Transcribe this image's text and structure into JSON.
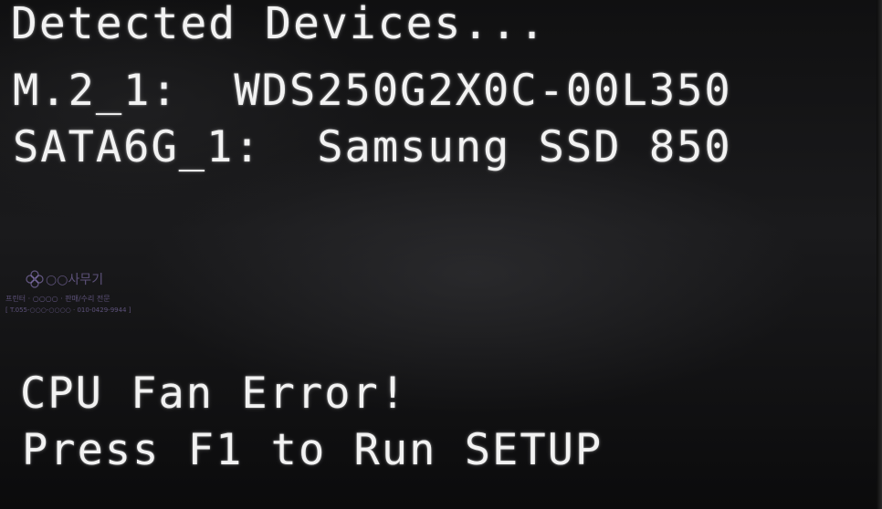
{
  "bios_screen": {
    "lines": {
      "detected_header": "Detected Devices...",
      "m2_device": "M.2_1:  WDS250G2X0C-00L350",
      "sata_device": "SATA6G_1:  Samsung SSD 850",
      "error_message": "CPU Fan Error!",
      "prompt": "Press F1 to Run SETUP"
    }
  },
  "watermark": {
    "title": "○○사무기",
    "subtitle": "프린터 · ○○○○ · 판매/수리 전문",
    "phone": "[ T.055-○○○-○○○○ · 010-0429-9944 ]"
  },
  "colors": {
    "text": "#f2f2f2",
    "background": "#111112",
    "watermark": "#9682c8"
  }
}
